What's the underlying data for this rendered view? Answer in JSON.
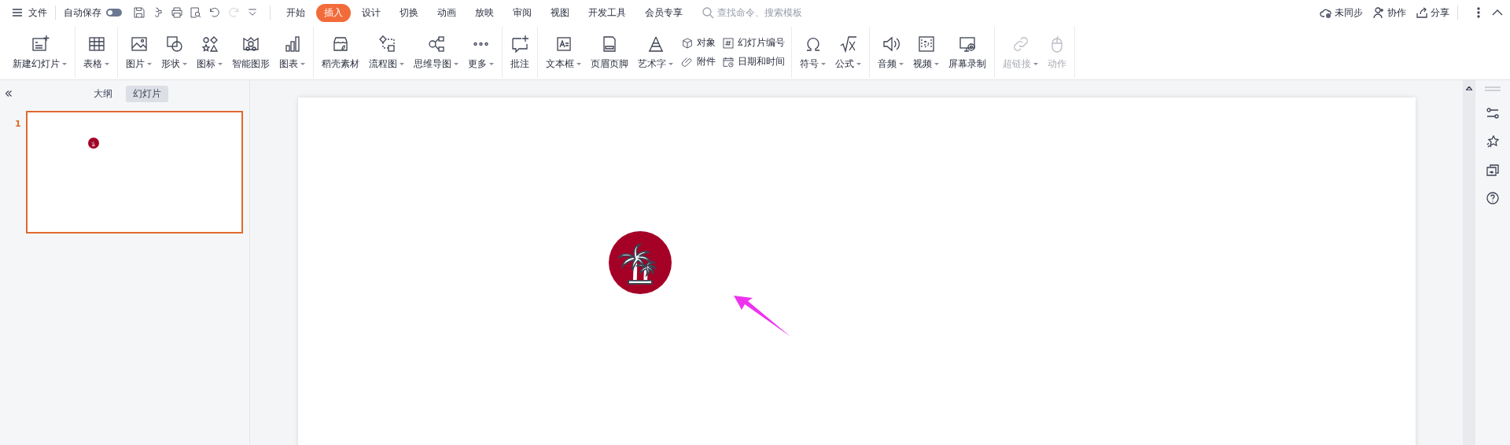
{
  "menu": {
    "label": "文件"
  },
  "autosave": {
    "label": "自动保存",
    "on": false
  },
  "quick_access": [
    {
      "disabled": false
    },
    {
      "disabled": false
    },
    {
      "disabled": false
    },
    {
      "disabled": false
    },
    {
      "disabled": false
    },
    {
      "disabled": true
    },
    {
      "disabled": false
    }
  ],
  "tabs": [
    {
      "label": "开始",
      "selected": false
    },
    {
      "label": "插入",
      "selected": true
    },
    {
      "label": "设计",
      "selected": false
    },
    {
      "label": "切换",
      "selected": false
    },
    {
      "label": "动画",
      "selected": false
    },
    {
      "label": "放映",
      "selected": false
    },
    {
      "label": "审阅",
      "selected": false
    },
    {
      "label": "视图",
      "selected": false
    },
    {
      "label": "开发工具",
      "selected": false
    },
    {
      "label": "会员专享",
      "selected": false
    }
  ],
  "search": {
    "placeholder": "查找命令、搜索模板"
  },
  "actions": [
    {
      "label": "未同步"
    },
    {
      "label": "协作"
    },
    {
      "label": "分享"
    }
  ],
  "ribbon": {
    "groups": [
      {
        "items": [
          {
            "kind": "big",
            "label": "新建幻灯片",
            "dropdown": true,
            "disabled": false
          }
        ]
      },
      {
        "items": [
          {
            "kind": "big",
            "label": "表格",
            "dropdown": true,
            "disabled": false
          }
        ]
      },
      {
        "items": [
          {
            "kind": "big",
            "label": "图片",
            "dropdown": true,
            "disabled": false
          },
          {
            "kind": "big",
            "label": "形状",
            "dropdown": true,
            "disabled": false
          },
          {
            "kind": "big",
            "label": "图标",
            "dropdown": true,
            "disabled": false
          },
          {
            "kind": "big",
            "label": "智能图形",
            "dropdown": false,
            "disabled": false
          },
          {
            "kind": "big",
            "label": "图表",
            "dropdown": true,
            "disabled": false
          }
        ]
      },
      {
        "items": [
          {
            "kind": "big",
            "label": "稻壳素材",
            "dropdown": false,
            "disabled": false
          },
          {
            "kind": "big",
            "label": "流程图",
            "dropdown": true,
            "disabled": false
          },
          {
            "kind": "big",
            "label": "思维导图",
            "dropdown": true,
            "disabled": false
          },
          {
            "kind": "big",
            "label": "更多",
            "dropdown": true,
            "disabled": false
          }
        ]
      },
      {
        "items": [
          {
            "kind": "big",
            "label": "批注",
            "dropdown": false,
            "disabled": false
          }
        ]
      },
      {
        "items": [
          {
            "kind": "big",
            "label": "文本框",
            "dropdown": true,
            "disabled": false
          },
          {
            "kind": "big",
            "label": "页眉页脚",
            "dropdown": false,
            "disabled": false
          },
          {
            "kind": "big",
            "label": "艺术字",
            "dropdown": true,
            "disabled": false
          },
          {
            "kind": "stack",
            "items": [
              {
                "label": "对象"
              },
              {
                "label": "附件"
              }
            ]
          },
          {
            "kind": "stack",
            "items": [
              {
                "label": "幻灯片编号"
              },
              {
                "label": "日期和时间"
              }
            ]
          }
        ]
      },
      {
        "items": [
          {
            "kind": "big",
            "label": "符号",
            "dropdown": true,
            "disabled": false
          },
          {
            "kind": "big",
            "label": "公式",
            "dropdown": true,
            "disabled": false
          }
        ]
      },
      {
        "items": [
          {
            "kind": "big",
            "label": "音频",
            "dropdown": true,
            "disabled": false
          },
          {
            "kind": "big",
            "label": "视频",
            "dropdown": true,
            "disabled": false
          },
          {
            "kind": "big",
            "label": "屏幕录制",
            "dropdown": false,
            "disabled": false
          }
        ]
      },
      {
        "items": [
          {
            "kind": "big",
            "label": "超链接",
            "dropdown": true,
            "disabled": true
          },
          {
            "kind": "big",
            "label": "动作",
            "dropdown": false,
            "disabled": true
          }
        ]
      }
    ]
  },
  "panel": {
    "tabs": [
      {
        "label": "大纲",
        "selected": false
      },
      {
        "label": "幻灯片",
        "selected": true
      }
    ],
    "slides": [
      {
        "number": "1",
        "selected": true
      }
    ]
  }
}
